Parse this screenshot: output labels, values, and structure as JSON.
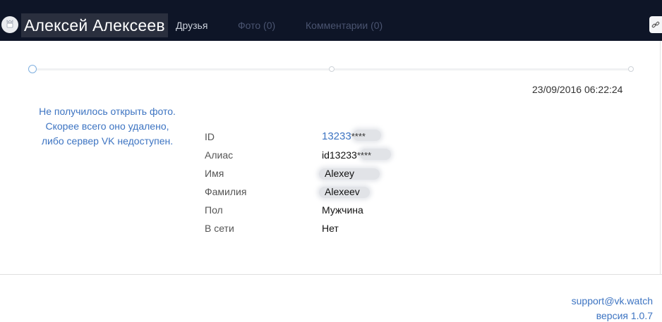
{
  "header": {
    "user_name": "Алексей Алексеев",
    "avatar_icon": "user-avatar-icon",
    "tabs": [
      {
        "label": "Друзья"
      },
      {
        "label": "Фото (0)"
      },
      {
        "label": "Комментарии (0)"
      }
    ],
    "link_icon": "link-icon"
  },
  "timeline": {
    "timestamp": "23/09/2016 06:22:24"
  },
  "photo_error": {
    "line1": "Не получилось открыть фото.",
    "line2": "Скорее всего оно удалено,",
    "line3": "либо сервер VK недоступен."
  },
  "profile": {
    "fields": [
      {
        "label": "ID",
        "value": "13233",
        "masked": "****"
      },
      {
        "label": "Алиас",
        "value": "id13233",
        "masked": "****"
      },
      {
        "label": "Имя",
        "value": "Alexey"
      },
      {
        "label": "Фамилия",
        "value": "Alexeev"
      },
      {
        "label": "Пол",
        "value": "Мужчина"
      },
      {
        "label": "В сети",
        "value": "Нет"
      }
    ]
  },
  "footer": {
    "support_email": "support@vk.watch",
    "version": "версия 1.0.7"
  },
  "colors": {
    "header_bg": "#0e1527",
    "link": "#3d74c2"
  }
}
